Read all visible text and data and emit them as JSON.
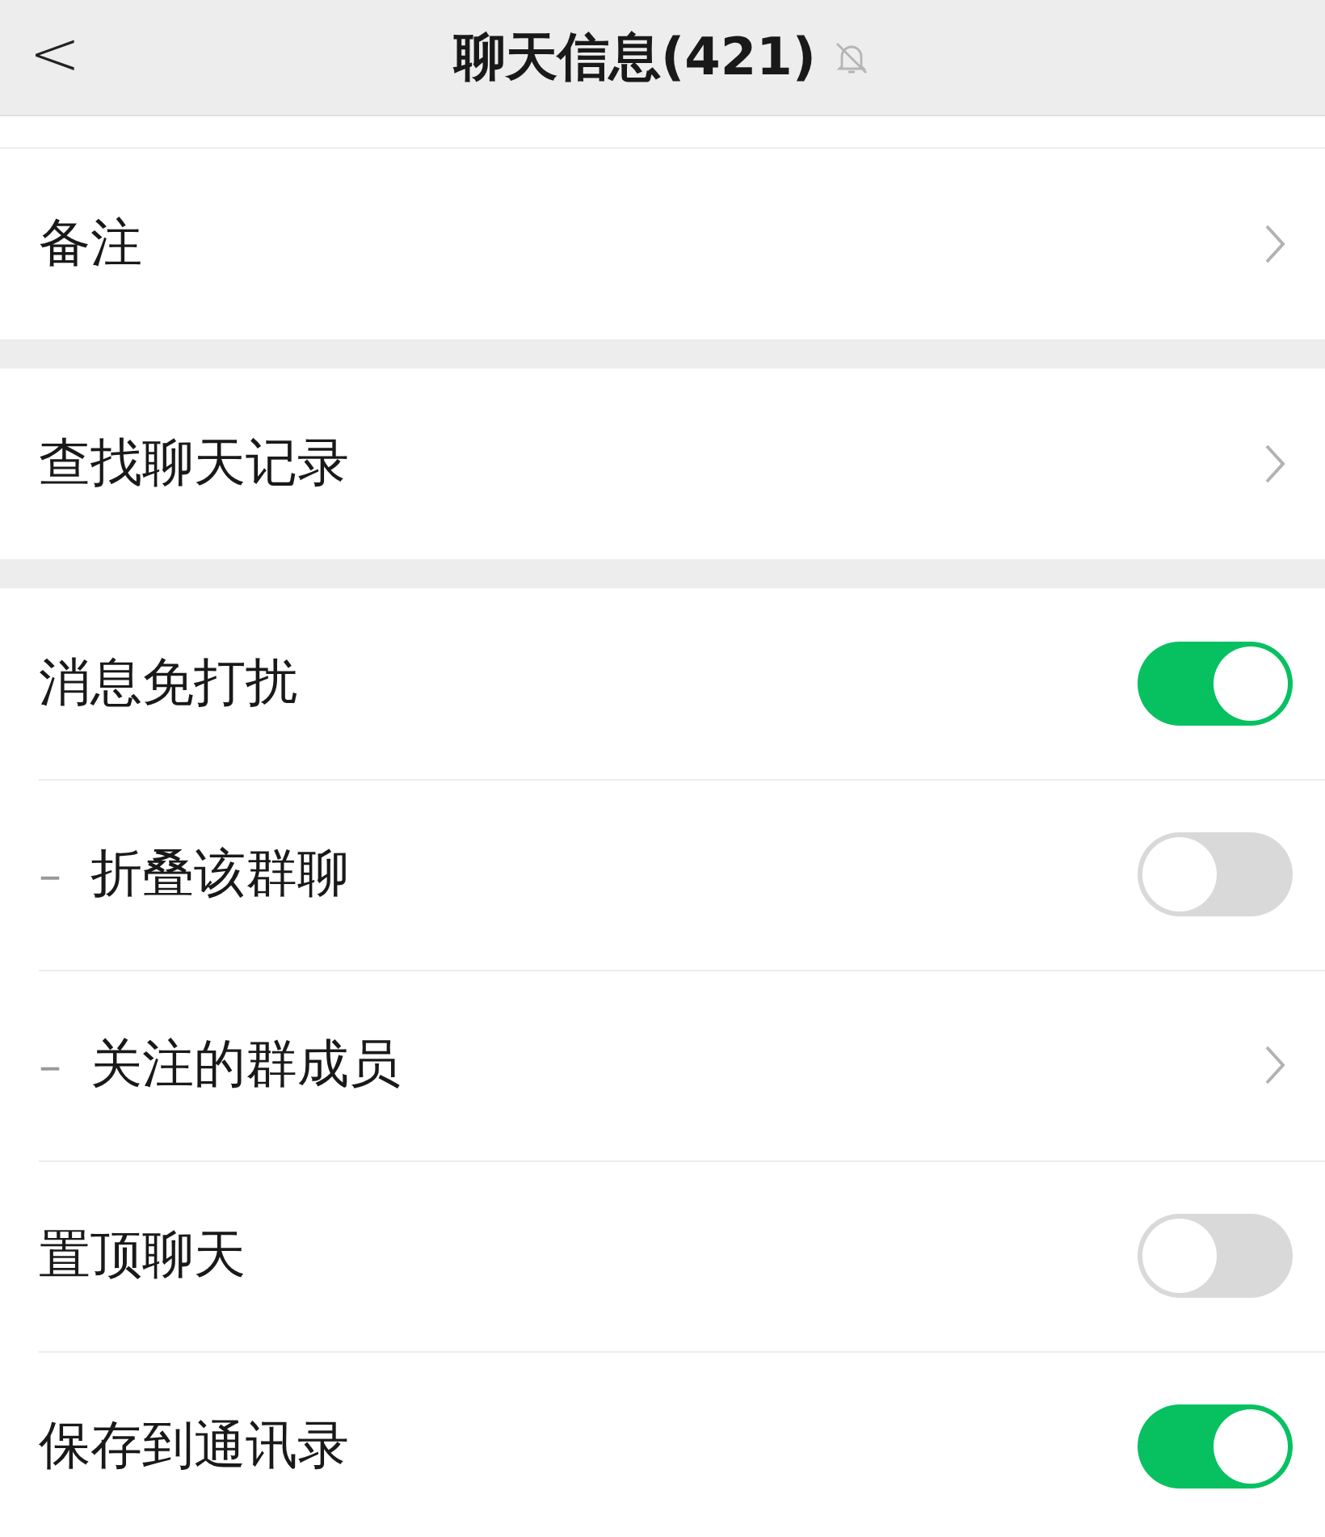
{
  "header": {
    "back": "<",
    "title": "聊天信息(421)"
  },
  "groups": [
    {
      "rows": [
        {
          "kind": "link",
          "label": "备注"
        }
      ]
    },
    {
      "rows": [
        {
          "kind": "link",
          "label": "查找聊天记录"
        }
      ]
    },
    {
      "rows": [
        {
          "kind": "toggle",
          "label": "消息免打扰",
          "on": true
        },
        {
          "kind": "toggle",
          "prefix": "–",
          "label": "折叠该群聊",
          "on": false
        },
        {
          "kind": "link",
          "prefix": "–",
          "label": "关注的群成员"
        },
        {
          "kind": "toggle",
          "label": "置顶聊天",
          "on": false
        },
        {
          "kind": "toggle",
          "label": "保存到通讯录",
          "on": true
        }
      ]
    }
  ]
}
